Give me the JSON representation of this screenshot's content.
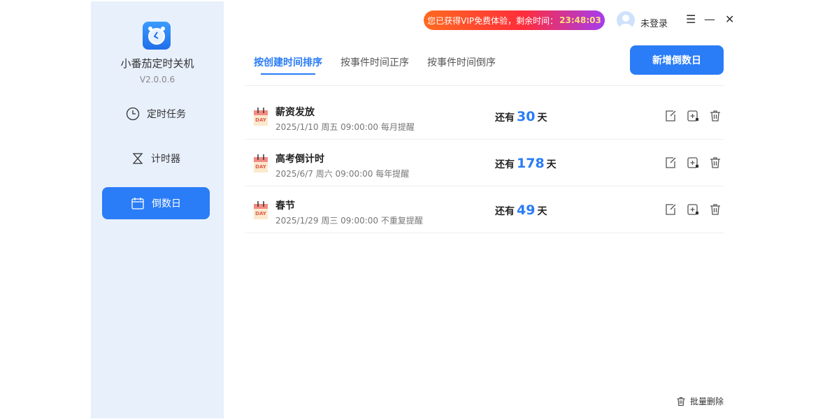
{
  "app": {
    "name": "小番茄定时关机",
    "version": "V2.0.0.6"
  },
  "nav": [
    {
      "label": "定时任务",
      "icon": "clock-icon"
    },
    {
      "label": "计时器",
      "icon": "hourglass-icon"
    },
    {
      "label": "倒数日",
      "icon": "calendar-icon",
      "active": true
    }
  ],
  "vip": {
    "text": "您已获得VIP免费体验，剩余时间：",
    "time": "23:48:03"
  },
  "user": {
    "label": "未登录"
  },
  "tabs": [
    {
      "label": "按创建时间排序",
      "active": true
    },
    {
      "label": "按事件时间正序"
    },
    {
      "label": "按事件时间倒序"
    }
  ],
  "add_button": "新增倒数日",
  "items": [
    {
      "title": "薪资发放",
      "sub": "2025/1/10 周五 09:00:00 每月提醒",
      "prefix": "还有",
      "days": "30",
      "suffix": "天"
    },
    {
      "title": "高考倒计时",
      "sub": "2025/6/7 周六 09:00:00 每年提醒",
      "prefix": "还有",
      "days": "178",
      "suffix": "天"
    },
    {
      "title": "春节",
      "sub": "2025/1/29 周三 09:00:00 不重复提醒",
      "prefix": "还有",
      "days": "49",
      "suffix": "天"
    }
  ],
  "bulk_delete": "批量删除",
  "colors": {
    "accent": "#2a7cf7",
    "sidebar": "#e8f0fc"
  }
}
